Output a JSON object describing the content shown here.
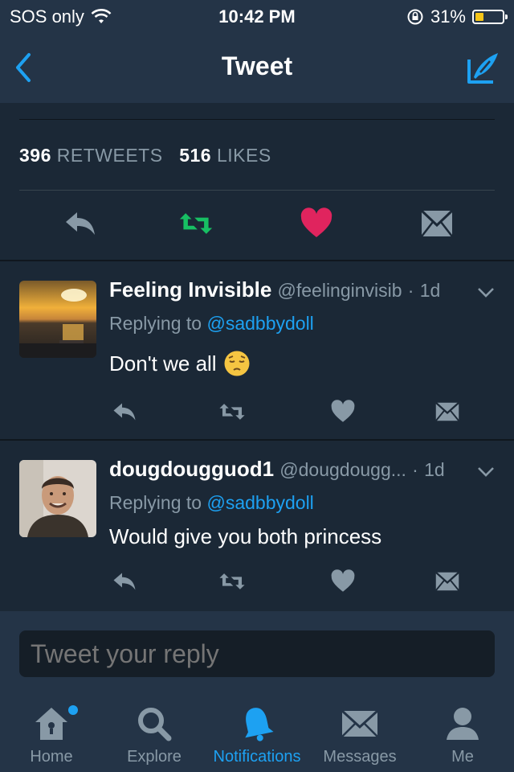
{
  "status_bar": {
    "carrier": "SOS only",
    "time": "10:42 PM",
    "battery_percent": "31%",
    "battery_level": 0.31,
    "icons": [
      "wifi-icon",
      "rotation-lock-icon",
      "battery-icon"
    ]
  },
  "navbar": {
    "title": "Tweet",
    "back_icon": "chevron-left-icon",
    "compose_icon": "compose-quill-icon"
  },
  "stats": {
    "retweets_count": "396",
    "retweets_label": "RETWEETS",
    "likes_count": "516",
    "likes_label": "LIKES"
  },
  "main_actions": [
    {
      "name": "reply",
      "icon": "reply-icon"
    },
    {
      "name": "retweet",
      "icon": "retweet-icon",
      "color": "#17bf63"
    },
    {
      "name": "like",
      "icon": "heart-icon",
      "color": "#e0245e"
    },
    {
      "name": "message",
      "icon": "envelope-icon"
    }
  ],
  "replies": [
    {
      "name": "Feeling Invisible",
      "handle": "@feelinginvisib",
      "time": "1d",
      "replying_prefix": "Replying to",
      "replying_to": "@sadbbydoll",
      "text": "Don't we all",
      "emoji": "😔"
    },
    {
      "name": "dougdougguod1",
      "handle": "@dougdougg...",
      "time": "1d",
      "replying_prefix": "Replying to",
      "replying_to": "@sadbbydoll",
      "text": "Would give you both princess",
      "emoji": ""
    }
  ],
  "reply_input": {
    "placeholder": "Tweet your reply"
  },
  "tabs": [
    {
      "label": "Home",
      "icon": "home-icon",
      "active": false,
      "has_badge": true
    },
    {
      "label": "Explore",
      "icon": "search-icon",
      "active": false
    },
    {
      "label": "Notifications",
      "icon": "bell-icon",
      "active": true
    },
    {
      "label": "Messages",
      "icon": "envelope-icon",
      "active": false
    },
    {
      "label": "Me",
      "icon": "person-icon",
      "active": false
    }
  ],
  "colors": {
    "background": "#1b2836",
    "bar": "#243447",
    "accent": "#1da1f2",
    "muted": "#8899a6",
    "retweet_green": "#17bf63",
    "like_red": "#e0245e"
  }
}
